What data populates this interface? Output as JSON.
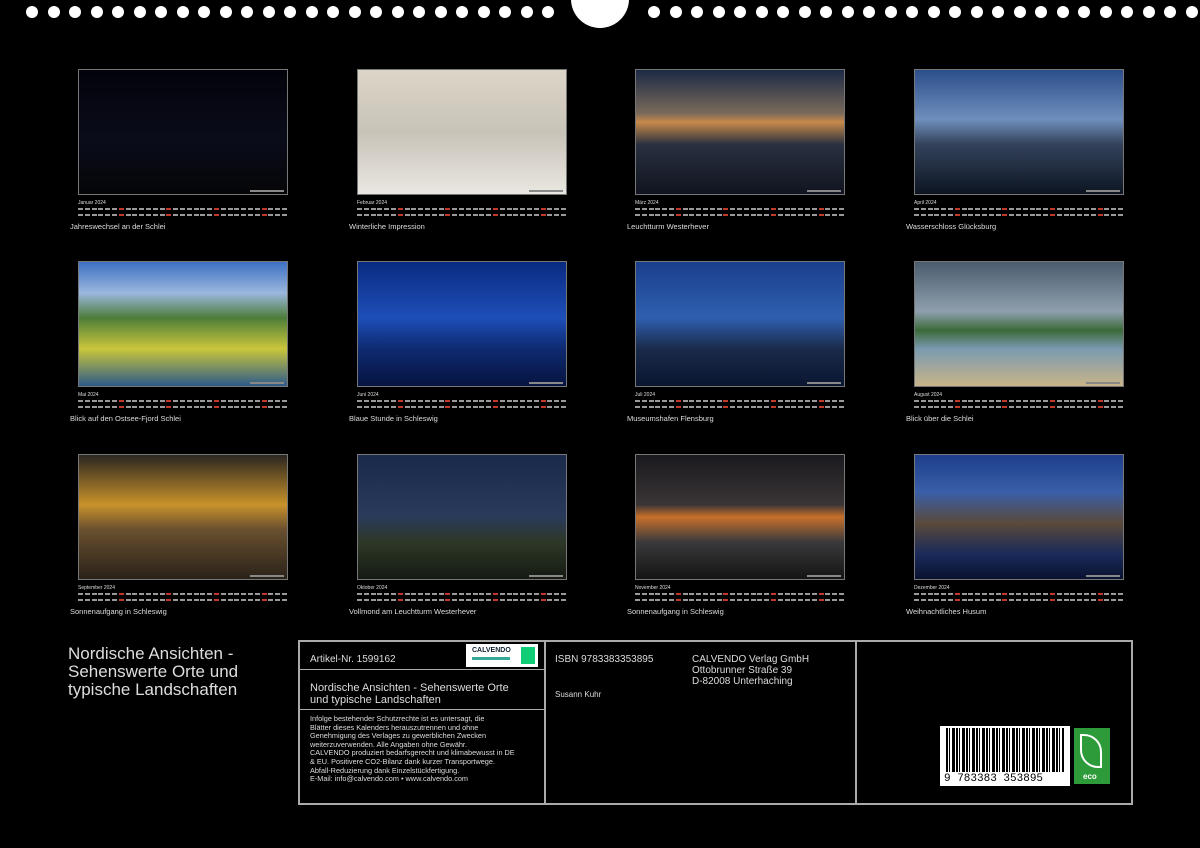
{
  "months": [
    {
      "month": "Januar 2024",
      "caption": "Jahreswechsel an der Schlei",
      "gradient": "linear-gradient(180deg,#02030a 0%,#0a0c1a 55%,#050608 100%)"
    },
    {
      "month": "Februar 2024",
      "caption": "Winterliche Impression",
      "gradient": "linear-gradient(180deg,#ddd6c8 0%,#c8c3b8 50%,#eae7e2 100%)"
    },
    {
      "month": "März 2024",
      "caption": "Leuchtturm Westerhever",
      "gradient": "linear-gradient(180deg,#1c2a45 0%,#7a6a5a 35%,#c98a4a 42%,#2a3040 60%,#101420 100%)"
    },
    {
      "month": "April 2024",
      "caption": "Wasserschloss Glücksburg",
      "gradient": "linear-gradient(180deg,#2b4f8a 0%,#6f8fbd 40%,#33425a 60%,#0d1522 100%)"
    },
    {
      "month": "Mai 2024",
      "caption": "Blick auf den Ostsee-Fjord Schlei",
      "gradient": "linear-gradient(180deg,#3c6fc2 0%,#9bb8de 25%,#4d7d3a 45%,#c9c63a 70%,#2d5a8a 100%)"
    },
    {
      "month": "Juni 2024",
      "caption": "Blaue Stunde in Schleswig",
      "gradient": "linear-gradient(180deg,#0a2a80 0%,#1d4fb8 45%,#0e2a70 70%,#061440 100%)"
    },
    {
      "month": "Juli 2024",
      "caption": "Museumshafen Flensburg",
      "gradient": "linear-gradient(180deg,#1a3f8c 0%,#2f5fb0 45%,#1a2a4a 70%,#0a1630 100%)"
    },
    {
      "month": "August 2024",
      "caption": "Blick über die Schlei",
      "gradient": "linear-gradient(180deg,#4a5c6e 0%,#8f9fae 40%,#3c6a3a 55%,#7a9ab0 70%,#c8b488 100%)"
    },
    {
      "month": "September 2024",
      "caption": "Sonnenaufgang in Schleswig",
      "gradient": "linear-gradient(180deg,#2a2620 0%,#c9922a 40%,#6a5030 60%,#2a2218 100%)"
    },
    {
      "month": "Oktober 2024",
      "caption": "Vollmond am Leuchtturm Westerhever",
      "gradient": "linear-gradient(180deg,#1a2a4a 0%,#2a3a5a 50%,#2e3828 70%,#151a12 100%)"
    },
    {
      "month": "November 2024",
      "caption": "Sonnenaufgang in Schleswig",
      "gradient": "linear-gradient(180deg,#1a1a1e 0%,#3a3436 40%,#c8702a 50%,#3a3a3c 70%,#151515 100%)"
    },
    {
      "month": "Dezember 2024",
      "caption": "Weihnachtliches Husum",
      "gradient": "linear-gradient(180deg,#1e3e8c 0%,#3a5fa8 30%,#5a4a3a 55%,#1a2a5a 80%,#0a1230 100%)"
    }
  ],
  "product": {
    "title": "Nordische Ansichten - Sehenswerte Orte und typische Landschaften",
    "article": "Artikel-Nr. 1599162",
    "logo_text": "CALVENDO",
    "subtitle_line1": "Nordische Ansichten - Sehenswerte Orte",
    "subtitle_line2": "und typische Landschaften",
    "legal": [
      "Infolge bestehender Schutzrechte ist es untersagt, die",
      "Blätter dieses Kalenders herauszutrennen und ohne",
      "Genehmigung des Verlages zu gewerblichen Zwecken",
      "weiterzuverwenden. Alle Angaben ohne Gewähr.",
      "CALVENDO produziert bedarfsgerecht und klimabewusst in DE",
      "& EU. Positivere CO2-Bilanz dank kurzer Transportwege.",
      "Abfall-Reduzierung dank Einzelstückfertigung.",
      "E-Mail: info@calvendo.com • www.calvendo.com"
    ],
    "isbn": "ISBN 9783383353895",
    "author": "Susann Kuhr",
    "publisher": [
      "CALVENDO Verlag GmbH",
      "Ottobrunner Straße 39",
      "D-82008 Unterhaching"
    ],
    "barcode_number": "9 783383 353895",
    "eco_label": "eco"
  },
  "colors": {
    "background": "#000000",
    "box_border": "#aaaaaa",
    "sunday_red": "#c0392b",
    "eco_green": "#2e9b3a"
  }
}
